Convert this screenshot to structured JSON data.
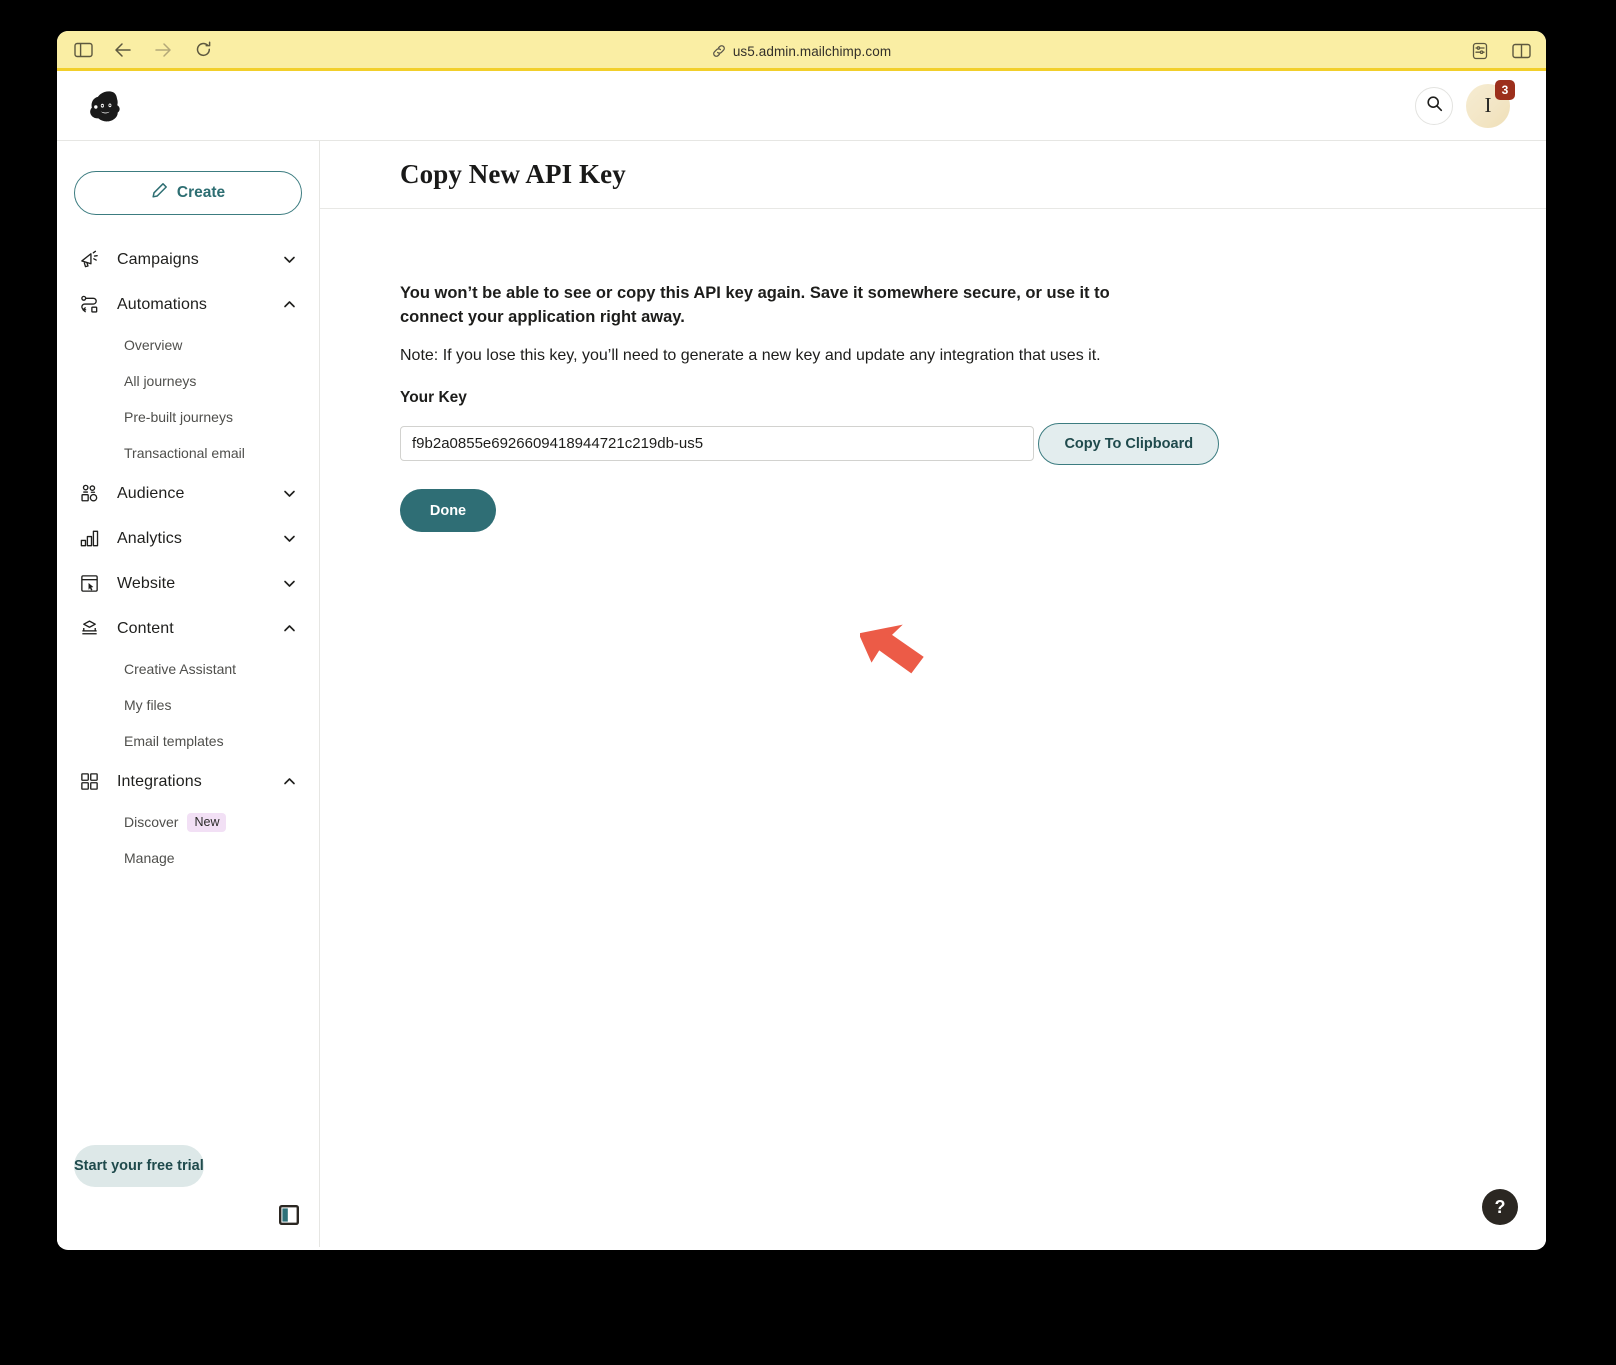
{
  "browser": {
    "url": "us5.admin.mailchimp.com",
    "toolbar_left": [
      {
        "name": "sidebar-toggle-icon",
        "label": "Show Sidebar"
      },
      {
        "name": "back-icon",
        "label": "Back"
      },
      {
        "name": "forward-icon",
        "label": "Forward"
      },
      {
        "name": "reload-icon",
        "label": "Reload"
      }
    ],
    "toolbar_right": [
      {
        "name": "reader-settings-icon",
        "label": "Page Settings"
      },
      {
        "name": "split-view-icon",
        "label": "Tab Overview"
      }
    ],
    "link_icon": "link-icon"
  },
  "header": {
    "logo_alt": "Mailchimp",
    "search_icon": "search-icon",
    "avatar_initial": "I",
    "avatar_badge": "3"
  },
  "sidebar": {
    "create_label": "Create",
    "create_icon": "pencil-icon",
    "groups": [
      {
        "label": "Campaigns",
        "icon": "megaphone-icon",
        "expanded": false,
        "chevron": "chevron-down-icon",
        "items": []
      },
      {
        "label": "Automations",
        "icon": "automation-flow-icon",
        "expanded": true,
        "chevron": "chevron-up-icon",
        "items": [
          {
            "label": "Overview"
          },
          {
            "label": "All journeys"
          },
          {
            "label": "Pre-built journeys"
          },
          {
            "label": "Transactional email"
          }
        ]
      },
      {
        "label": "Audience",
        "icon": "people-icon",
        "expanded": false,
        "chevron": "chevron-down-icon",
        "items": []
      },
      {
        "label": "Analytics",
        "icon": "bar-chart-icon",
        "expanded": false,
        "chevron": "chevron-down-icon",
        "items": []
      },
      {
        "label": "Website",
        "icon": "window-cursor-icon",
        "expanded": false,
        "chevron": "chevron-down-icon",
        "items": []
      },
      {
        "label": "Content",
        "icon": "content-stack-icon",
        "expanded": true,
        "chevron": "chevron-up-icon",
        "items": [
          {
            "label": "Creative Assistant"
          },
          {
            "label": "My files"
          },
          {
            "label": "Email templates"
          }
        ]
      },
      {
        "label": "Integrations",
        "icon": "grid-squares-icon",
        "expanded": true,
        "chevron": "chevron-up-icon",
        "items": [
          {
            "label": "Discover",
            "badge": "New"
          },
          {
            "label": "Manage"
          }
        ]
      }
    ],
    "trial_label": "Start your free trial",
    "collapse_icon": "panel-collapse-icon"
  },
  "main": {
    "page_title": "Copy New API Key",
    "warning": "You won’t be able to see or copy this API key again. Save it somewhere secure, or use it to connect your application right away.",
    "note": "Note: If you lose this key, you’ll need to generate a new key and update any integration that uses it.",
    "key_label": "Your Key",
    "key_value": "f9b2a0855e6926609418944721c219db-us5",
    "copy_label": "Copy To Clipboard",
    "done_label": "Done",
    "help_label": "?"
  },
  "annotation": {
    "arrow_icon": "red-arrow-pointer",
    "arrow_color": "#ec5b47"
  },
  "colors": {
    "brand_teal": "#2f6e75",
    "toolbar_yellow": "#faeea4",
    "badge_red": "#9c2f1c",
    "badge_new_bg": "#f2e0f5",
    "trial_bg": "#dde8e8"
  }
}
